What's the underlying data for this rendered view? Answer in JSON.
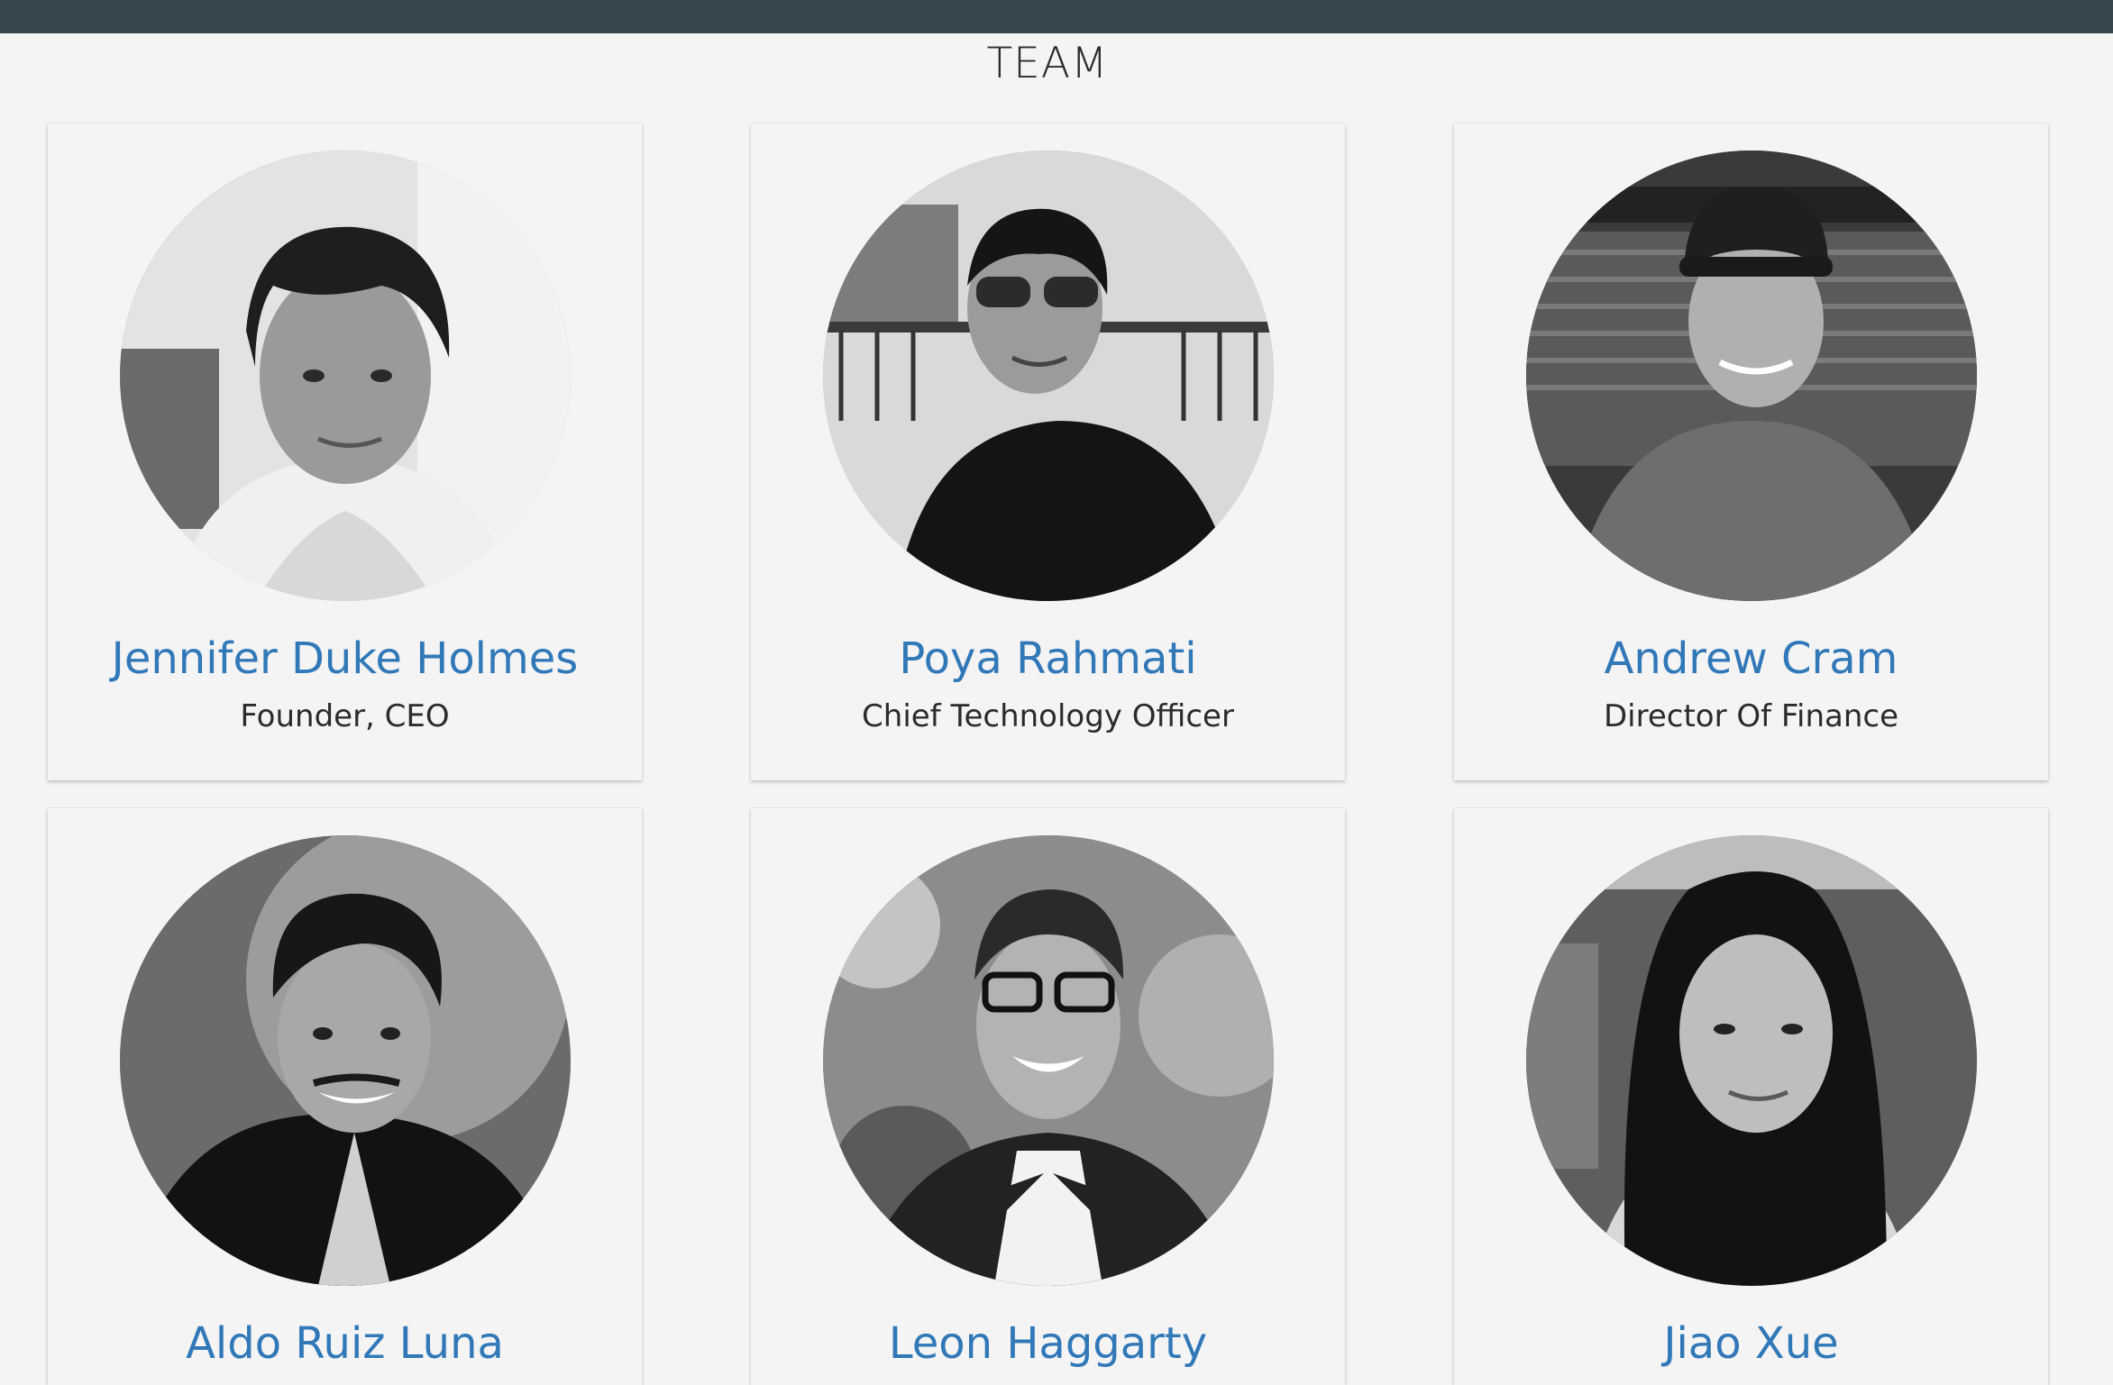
{
  "section": {
    "title": "TEAM"
  },
  "colors": {
    "topbar": "#36474f",
    "background": "#f4f4f4",
    "name_link": "#3178b8",
    "text": "#2b2b2b"
  },
  "team": {
    "members": [
      {
        "name": "Jennifer Duke Holmes",
        "role": "Founder, CEO",
        "photo_icon": "person-photo"
      },
      {
        "name": "Poya Rahmati",
        "role": "Chief Technology Officer",
        "photo_icon": "person-photo"
      },
      {
        "name": "Andrew Cram",
        "role": "Director Of Finance",
        "photo_icon": "person-photo"
      },
      {
        "name": "Aldo Ruiz Luna",
        "role": "",
        "photo_icon": "person-photo"
      },
      {
        "name": "Leon Haggarty",
        "role": "",
        "photo_icon": "person-photo"
      },
      {
        "name": "Jiao Xue",
        "role": "",
        "photo_icon": "person-photo"
      }
    ]
  }
}
